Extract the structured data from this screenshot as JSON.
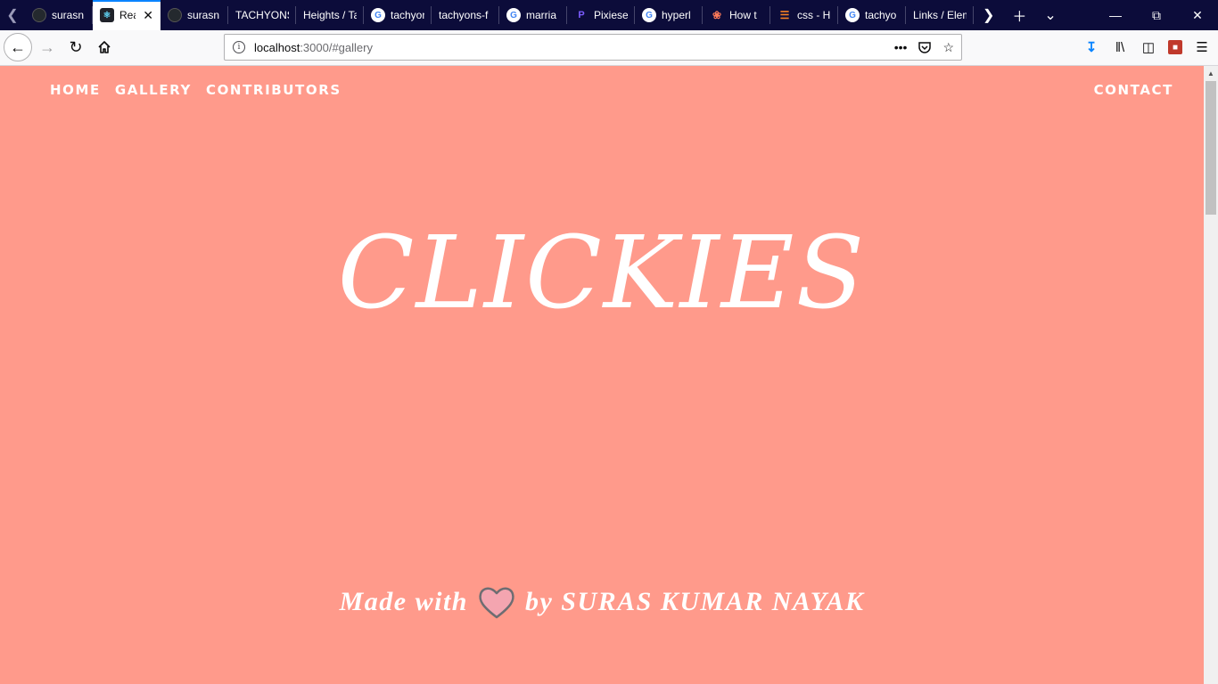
{
  "tabs": [
    {
      "label": "surasn",
      "icon": "github-icon",
      "active": false
    },
    {
      "label": "React App",
      "icon": "react-icon",
      "active": true
    },
    {
      "label": "surasn",
      "icon": "github-icon",
      "active": false
    },
    {
      "label": "TACHYONS",
      "icon": "",
      "active": false
    },
    {
      "label": "Heights / Tachyons",
      "icon": "",
      "active": false
    },
    {
      "label": "tachyons",
      "icon": "google-icon",
      "active": false
    },
    {
      "label": "tachyons-f",
      "icon": "",
      "active": false
    },
    {
      "label": "marria",
      "icon": "google-icon",
      "active": false
    },
    {
      "label": "Pixiese",
      "icon": "pixie-icon",
      "active": false
    },
    {
      "label": "hyperl",
      "icon": "google-icon",
      "active": false
    },
    {
      "label": "How t",
      "icon": "hubspot-icon",
      "active": false
    },
    {
      "label": "css - H",
      "icon": "stackoverflow-icon",
      "active": false
    },
    {
      "label": "tachyo",
      "icon": "google-icon",
      "active": false
    },
    {
      "label": "Links / Elements",
      "icon": "",
      "active": false
    }
  ],
  "browser": {
    "url_host": "localhost",
    "url_rest": ":3000/#gallery"
  },
  "site": {
    "nav": {
      "home": "HOME",
      "gallery": "GALLERY",
      "contributors": "CONTRIBUTORS",
      "contact": "CONTACT"
    },
    "title": "CLICKIES",
    "footer": {
      "prefix": "Made with",
      "suffix": "by SURAS KUMAR NAYAK"
    }
  },
  "colors": {
    "page_background": "#ff9a8b",
    "tab_strip": "#0c0c3a",
    "heart_fill": "#f4a5b0"
  }
}
